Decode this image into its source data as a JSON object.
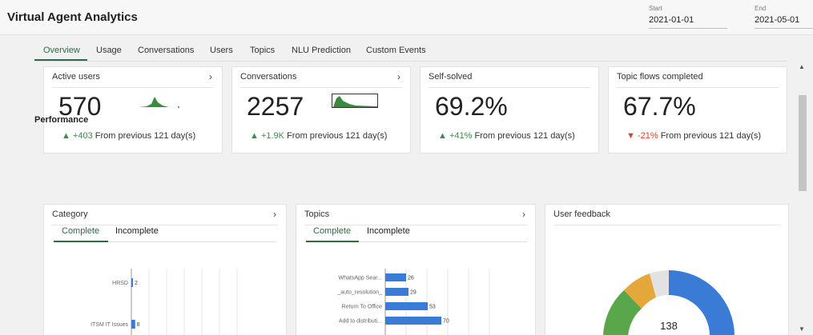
{
  "header": {
    "title": "Virtual Agent Analytics",
    "start_label": "Start",
    "start_value": "2021-01-01",
    "end_label": "End",
    "end_value": "2021-05-01"
  },
  "tabs": [
    "Overview",
    "Usage",
    "Conversations",
    "Users",
    "Topics",
    "NLU Prediction",
    "Custom Events"
  ],
  "active_tab": "Overview",
  "kpis": [
    {
      "title": "Active users",
      "value": "570",
      "delta": "+403",
      "delta_dir": "up",
      "period": "From previous 121 day(s)",
      "has_chevron": true
    },
    {
      "title": "Conversations",
      "value": "2257",
      "delta": "+1.9K",
      "delta_dir": "up",
      "period": "From previous 121 day(s)",
      "has_chevron": true
    },
    {
      "title": "Self-solved",
      "value": "69.2%",
      "delta": "+41%",
      "delta_dir": "up",
      "period": "From previous 121 day(s)",
      "has_chevron": false
    },
    {
      "title": "Topic flows completed",
      "value": "67.7%",
      "delta": "-21%",
      "delta_dir": "down",
      "period": "From previous 121 day(s)",
      "has_chevron": false
    }
  ],
  "performance": {
    "title": "Performance",
    "category": {
      "title": "Category",
      "tabs": [
        "Complete",
        "Incomplete"
      ],
      "items": [
        {
          "label": "HRSD",
          "value": 2
        },
        {
          "label": "ITSM IT Issues",
          "value": 8
        }
      ]
    },
    "topics": {
      "title": "Topics",
      "tabs": [
        "Complete",
        "Incomplete"
      ],
      "items": [
        {
          "label": "WhatsApp Sear...",
          "value": 26
        },
        {
          "label": "_auto_resolution_",
          "value": 29
        },
        {
          "label": "Return To Office",
          "value": 53
        },
        {
          "label": "Add to distributi...",
          "value": 70
        }
      ]
    },
    "feedback": {
      "title": "User feedback",
      "center_value": "138",
      "colors": {
        "blue": "#3a7bd5",
        "green": "#5aa64a",
        "yellow": "#e4a83a",
        "gray": "#e2e2e2"
      }
    }
  },
  "colors": {
    "accent": "#2e6b43",
    "bar": "#3a7bd5",
    "up": "#3f8a4f",
    "down": "#d1452b"
  }
}
